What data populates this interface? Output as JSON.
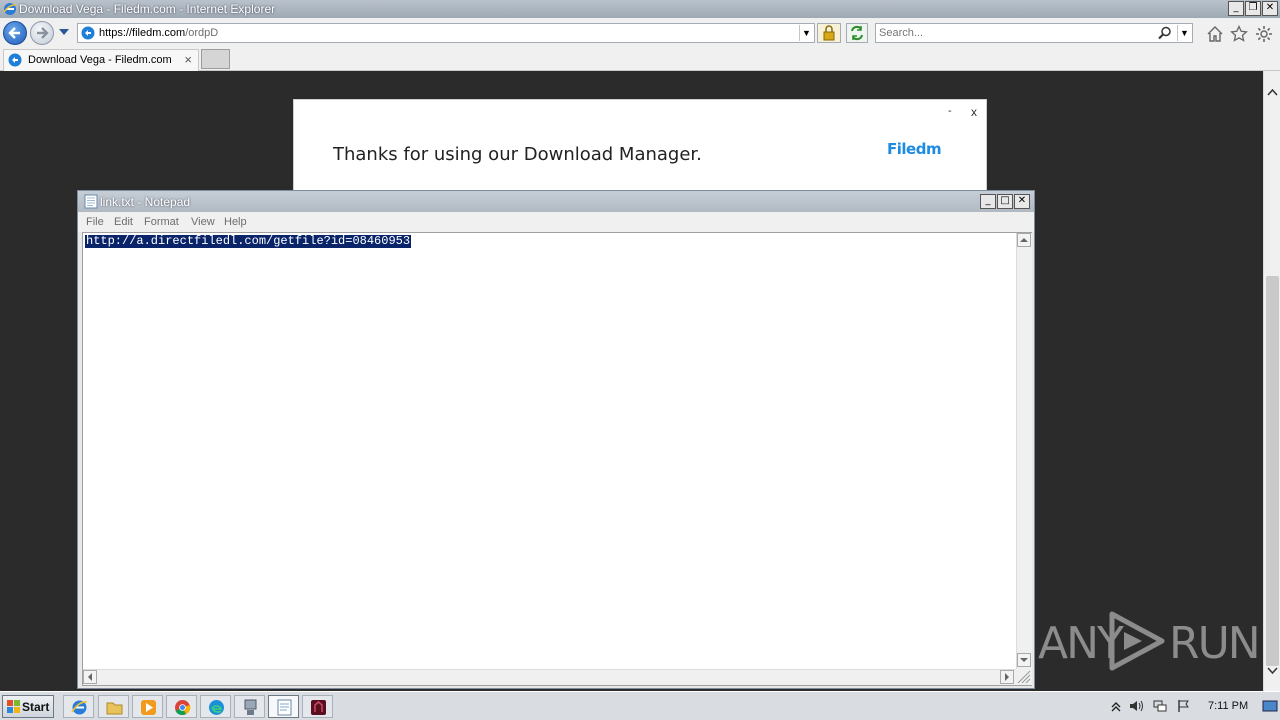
{
  "browser": {
    "window_title": "Download Vega - Filedm.com - Internet Explorer",
    "url_host": "https://filedm.com",
    "url_path": "/ordpD",
    "search_placeholder": "Search...",
    "tab_label": "Download Vega - Filedm.com",
    "tab_close": "×",
    "window_buttons": [
      "_",
      "❐",
      "✕"
    ]
  },
  "page": {
    "banner_message": "Thanks for using our Download Manager.",
    "brand": "Filedm",
    "minimize_label": "-",
    "close_label": "x"
  },
  "notepad": {
    "title": "link.txt - Notepad",
    "menu": [
      "File",
      "Edit",
      "Format",
      "View",
      "Help"
    ],
    "content": "http://a.directfiledl.com/getfile?id=08460953",
    "window_buttons": [
      "_",
      "□",
      "✕"
    ]
  },
  "watermark": {
    "left": "ANY",
    "right": "RUN"
  },
  "taskbar": {
    "start_label": "Start",
    "clock": "7:11 PM",
    "apps": [
      "internet-explorer",
      "file-explorer",
      "media-player",
      "chrome",
      "edge",
      "network-tool",
      "notepad",
      "app-dark-red"
    ]
  },
  "colors": {
    "selection": "#0a246a",
    "brand": "#1e8be3",
    "page_background": "#2b2b2b"
  }
}
